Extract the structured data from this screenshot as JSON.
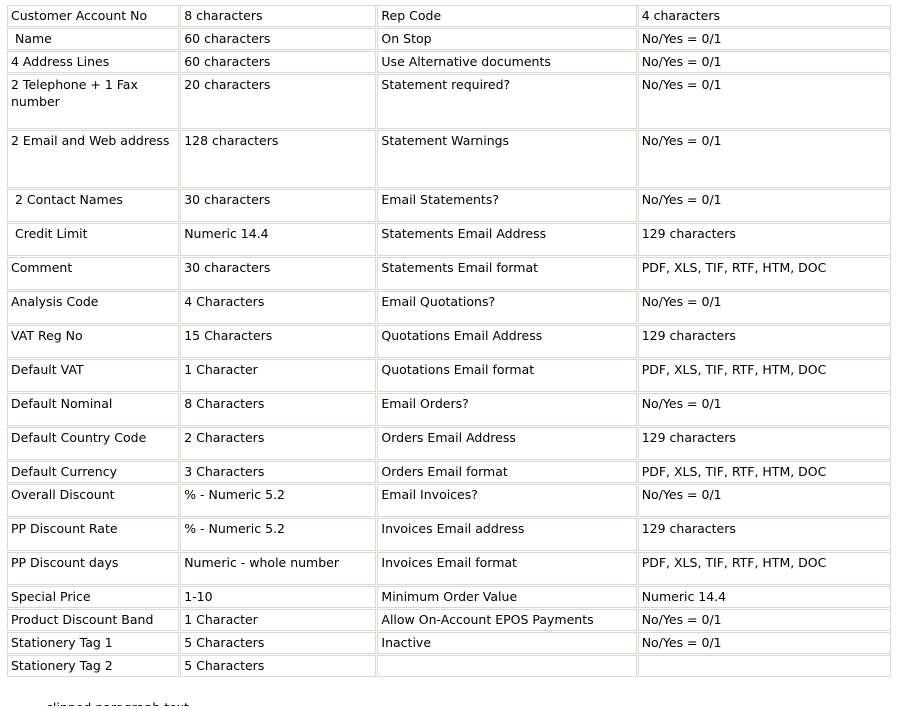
{
  "document": {
    "type": "specification-table",
    "colors": {
      "page_background": "#ffffff",
      "cell_border": "#d9d9cf",
      "row_highlight": "#ececec",
      "text": "#000000"
    },
    "columns": 4,
    "column_roles": [
      "field-name",
      "field-format",
      "field-name",
      "field-format"
    ]
  },
  "table": {
    "rows": [
      {
        "size": "h-sm",
        "cells": [
          "Customer Account No",
          "8 characters",
          "Rep Code",
          "4 characters"
        ],
        "shaded": [
          false,
          false,
          false,
          false
        ]
      },
      {
        "size": "h-sm",
        "cells": [
          " Name",
          "60 characters",
          "On Stop",
          "No/Yes = 0/1"
        ],
        "shaded": [
          false,
          false,
          false,
          false
        ]
      },
      {
        "size": "h-sm",
        "cells": [
          "4 Address Lines",
          "60 characters",
          "Use Alternative documents",
          "No/Yes = 0/1"
        ],
        "shaded": [
          true,
          false,
          false,
          false
        ]
      },
      {
        "size": "h-lg",
        "cells": [
          "2 Telephone + 1 Fax number",
          "20 characters",
          "Statement required?",
          "No/Yes = 0/1"
        ],
        "shaded": [
          false,
          false,
          false,
          false
        ]
      },
      {
        "size": "h-xl",
        "cells": [
          "2 Email and Web address",
          "128 characters",
          "Statement Warnings",
          "No/Yes = 0/1"
        ],
        "shaded": [
          true,
          false,
          false,
          false
        ]
      },
      {
        "size": "h-md",
        "cells": [
          " 2 Contact Names",
          "30 characters",
          "Email Statements?",
          "No/Yes = 0/1"
        ],
        "shaded": [
          false,
          false,
          false,
          false
        ]
      },
      {
        "size": "h-md",
        "cells": [
          " Credit Limit",
          "Numeric 14.4",
          "Statements Email Address",
          "129 characters"
        ],
        "shaded": [
          true,
          true,
          false,
          false
        ]
      },
      {
        "size": "h-md",
        "cells": [
          "Comment",
          "30 characters",
          "Statements Email format",
          "PDF, XLS, TIF, RTF, HTM, DOC"
        ],
        "shaded": [
          false,
          false,
          false,
          false
        ]
      },
      {
        "size": "h-md",
        "cells": [
          "Analysis Code",
          "4 Characters",
          "Email Quotations?",
          "No/Yes = 0/1"
        ],
        "shaded": [
          true,
          false,
          false,
          false
        ]
      },
      {
        "size": "h-md",
        "cells": [
          "VAT Reg No",
          "15 Characters",
          "Quotations Email Address",
          "129 characters"
        ],
        "shaded": [
          false,
          false,
          false,
          false
        ]
      },
      {
        "size": "h-md",
        "cells": [
          "Default VAT",
          "1 Character",
          "Quotations Email format",
          "PDF, XLS, TIF, RTF, HTM, DOC"
        ],
        "shaded": [
          false,
          false,
          false,
          false
        ]
      },
      {
        "size": "h-md",
        "cells": [
          "Default Nominal",
          "8 Characters",
          "Email Orders?",
          "No/Yes = 0/1"
        ],
        "shaded": [
          true,
          true,
          false,
          false
        ]
      },
      {
        "size": "h-md",
        "cells": [
          "Default Country Code",
          "2 Characters",
          "Orders Email Address",
          "129 characters"
        ],
        "shaded": [
          false,
          false,
          false,
          false
        ]
      },
      {
        "size": "h-sm",
        "cells": [
          "Default Currency",
          "3 Characters",
          "Orders Email format",
          "PDF, XLS, TIF, RTF, HTM, DOC"
        ],
        "shaded": [
          false,
          false,
          false,
          false
        ]
      },
      {
        "size": "h-md",
        "cells": [
          "Overall Discount",
          "% - Numeric 5.2",
          "Email Invoices?",
          "No/Yes = 0/1"
        ],
        "shaded": [
          false,
          false,
          false,
          false
        ]
      },
      {
        "size": "h-md",
        "cells": [
          "PP Discount Rate",
          "% - Numeric 5.2",
          "Invoices Email address",
          "129 characters"
        ],
        "shaded": [
          true,
          false,
          false,
          false
        ]
      },
      {
        "size": "h-md",
        "cells": [
          "PP Discount days",
          "Numeric - whole number",
          "Invoices Email format",
          "PDF, XLS, TIF, RTF, HTM, DOC"
        ],
        "shaded": [
          false,
          false,
          false,
          false
        ]
      },
      {
        "size": "h-sm",
        "cells": [
          "Special Price",
          "1-10",
          "Minimum Order Value",
          "Numeric 14.4"
        ],
        "shaded": [
          false,
          false,
          false,
          false
        ]
      },
      {
        "size": "h-sm",
        "cells": [
          "Product Discount Band",
          "1 Character",
          "Allow On-Account EPOS Payments",
          "No/Yes = 0/1"
        ],
        "shaded": [
          false,
          false,
          false,
          false
        ]
      },
      {
        "size": "h-sm",
        "cells": [
          "Stationery Tag 1",
          "5 Characters",
          "Inactive",
          "No/Yes = 0/1"
        ],
        "shaded": [
          false,
          false,
          false,
          false
        ]
      },
      {
        "size": "h-sm",
        "cells": [
          "Stationery Tag 2",
          "5 Characters",
          "",
          ""
        ],
        "shaded": [
          false,
          false,
          false,
          false
        ]
      }
    ]
  },
  "footer": {
    "clipped_line": "clipped paragraph text"
  }
}
